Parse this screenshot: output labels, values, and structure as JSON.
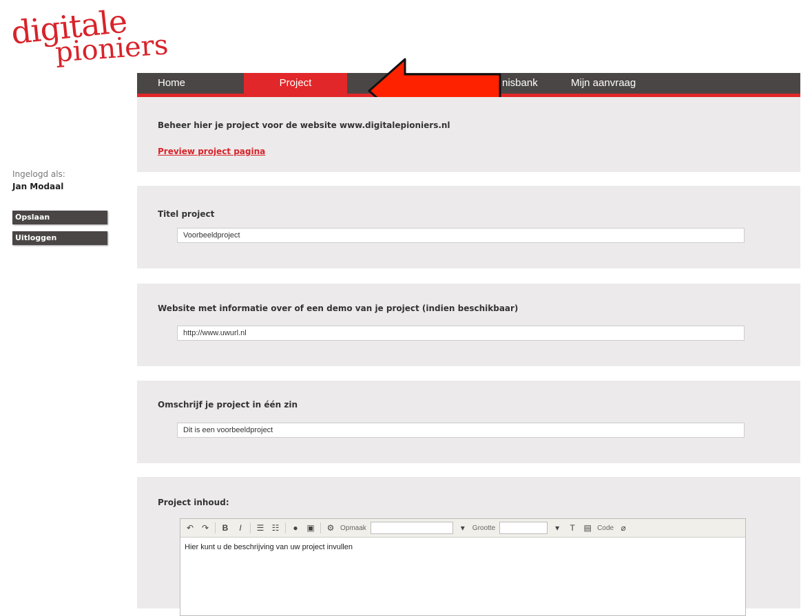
{
  "logo": {
    "line1": "digitale",
    "line2": "pioniers"
  },
  "nav": {
    "home": "Home",
    "project": "Project",
    "kennisbank": "nisbank",
    "aanvraag": "Mijn aanvraag"
  },
  "sidebar": {
    "logged_in_label": "Ingelogd als:",
    "user_name": "Jan Modaal",
    "save_label": "Opslaan",
    "logout_label": "Uitloggen"
  },
  "intro": {
    "text": "Beheer hier je project voor de website www.digitalepioniers.nl",
    "preview_link": "Preview project pagina"
  },
  "fields": {
    "title_label": "Titel project",
    "title_value": "Voorbeeldproject",
    "website_label": "Website met informatie over of een demo van je project (indien beschikbaar)",
    "website_value": "http://www.uwurl.nl",
    "description_label": "Omschrijf je project in één zin",
    "description_value": "Dit is een voorbeeldproject",
    "content_label": "Project inhoud:"
  },
  "editor": {
    "format_label": "Opmaak",
    "size_label": "Grootte",
    "code_label": "Code",
    "body_text": "Hier kunt u de beschrijving van uw project invullen"
  },
  "colors": {
    "brand_red": "#e12729",
    "nav_dark": "#4a4645",
    "panel_bg": "#eceaea"
  }
}
